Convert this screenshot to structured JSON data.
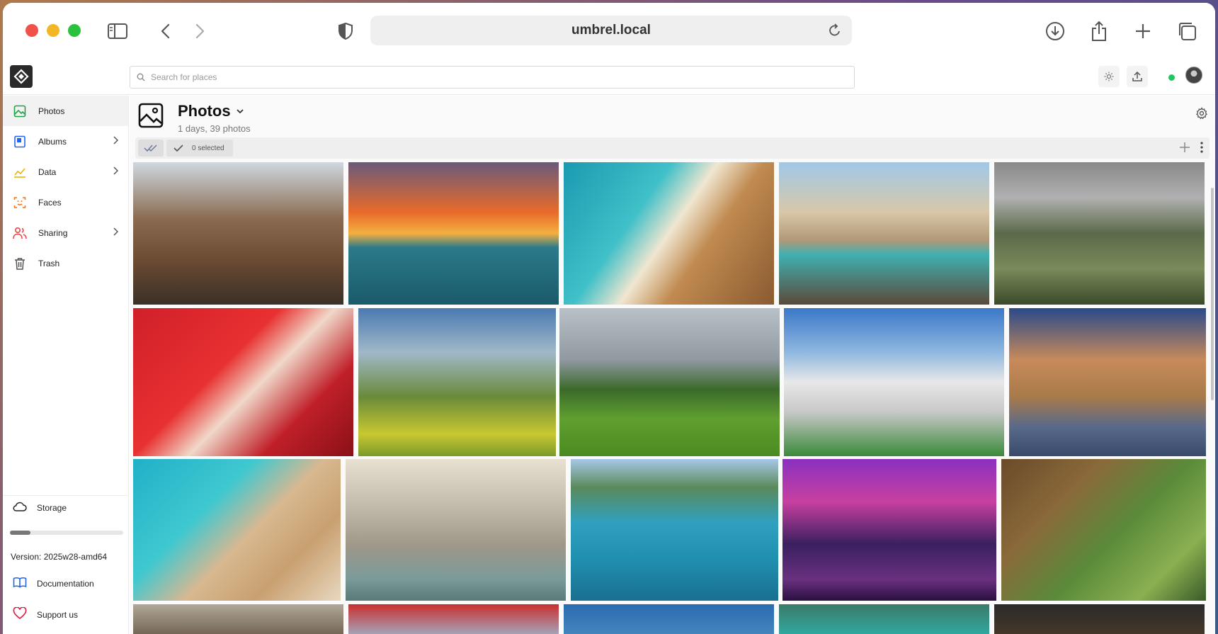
{
  "browser": {
    "url": "umbrel.local"
  },
  "header": {
    "search_placeholder": "Search for places"
  },
  "sidebar": {
    "items": [
      {
        "label": "Photos",
        "icon": "photos-icon",
        "color": "#22a34a",
        "has_chevron": false,
        "active": true
      },
      {
        "label": "Albums",
        "icon": "album-icon",
        "color": "#2563eb",
        "has_chevron": true,
        "active": false
      },
      {
        "label": "Data",
        "icon": "chart-icon",
        "color": "#eab308",
        "has_chevron": true,
        "active": false
      },
      {
        "label": "Faces",
        "icon": "face-scan-icon",
        "color": "#f97316",
        "has_chevron": false,
        "active": false
      },
      {
        "label": "Sharing",
        "icon": "users-icon",
        "color": "#ef4444",
        "has_chevron": true,
        "active": false
      },
      {
        "label": "Trash",
        "icon": "trash-icon",
        "color": "#555555",
        "has_chevron": false,
        "active": false
      }
    ],
    "storage_label": "Storage",
    "storage_used_fraction": 0.18,
    "version": "Version: 2025w28-amd64",
    "documentation_label": "Documentation",
    "support_label": "Support us"
  },
  "main": {
    "title": "Photos",
    "subtitle": "1 days, 39 photos",
    "selected_label": "0 selected"
  },
  "colors": {
    "accent_green": "#22c55e",
    "support_red": "#e11d48",
    "doc_blue": "#2563eb"
  },
  "photos": [
    {
      "name": "cable-cars-street"
    },
    {
      "name": "sailboat-sunset"
    },
    {
      "name": "aerial-beach-rocks"
    },
    {
      "name": "trevi-fountain-crowd"
    },
    {
      "name": "highland-river-valley"
    },
    {
      "name": "geisha-red-umbrella"
    },
    {
      "name": "old-man-of-storr"
    },
    {
      "name": "turf-house-field"
    },
    {
      "name": "vittoriano-monument"
    },
    {
      "name": "colosseum-dusk"
    },
    {
      "name": "aerial-turquoise-beach"
    },
    {
      "name": "fountain-statues"
    },
    {
      "name": "couple-boat-sea"
    },
    {
      "name": "city-tower-purple-night"
    },
    {
      "name": "pagoda-forest"
    },
    {
      "name": "row4-photo-1"
    },
    {
      "name": "row4-photo-2"
    },
    {
      "name": "row4-photo-3"
    },
    {
      "name": "row4-photo-4"
    },
    {
      "name": "row4-photo-5"
    }
  ]
}
